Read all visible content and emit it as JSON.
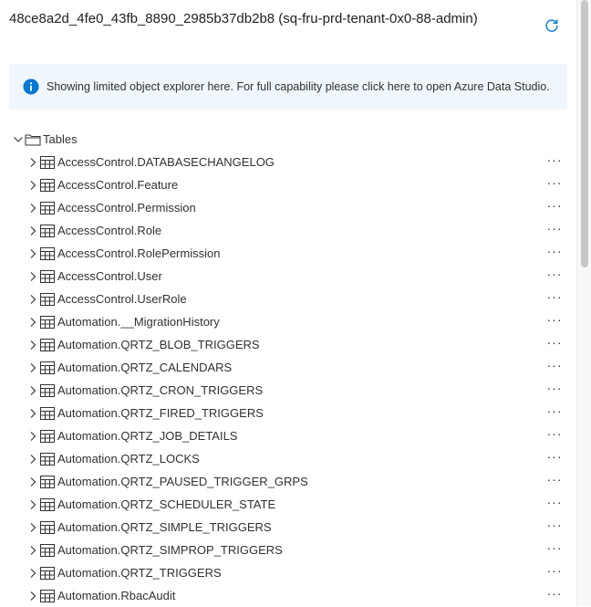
{
  "header": {
    "title": "48ce8a2d_4fe0_43fb_8890_2985b37db2b8 (sq-fru-prd-tenant-0x0-88-admin)",
    "refresh_icon": "refresh-icon"
  },
  "banner": {
    "icon": "info-icon",
    "text": "Showing limited object explorer here. For full capability please click here to open Azure Data Studio.",
    "background": "#eff6fc",
    "icon_color": "#0078d4"
  },
  "tree": {
    "root_label": "Tables",
    "root_expanded": true,
    "more_label": "···",
    "items": [
      "AccessControl.DATABASECHANGELOG",
      "AccessControl.Feature",
      "AccessControl.Permission",
      "AccessControl.Role",
      "AccessControl.RolePermission",
      "AccessControl.User",
      "AccessControl.UserRole",
      "Automation.__MigrationHistory",
      "Automation.QRTZ_BLOB_TRIGGERS",
      "Automation.QRTZ_CALENDARS",
      "Automation.QRTZ_CRON_TRIGGERS",
      "Automation.QRTZ_FIRED_TRIGGERS",
      "Automation.QRTZ_JOB_DETAILS",
      "Automation.QRTZ_LOCKS",
      "Automation.QRTZ_PAUSED_TRIGGER_GRPS",
      "Automation.QRTZ_SCHEDULER_STATE",
      "Automation.QRTZ_SIMPLE_TRIGGERS",
      "Automation.QRTZ_SIMPROP_TRIGGERS",
      "Automation.QRTZ_TRIGGERS",
      "Automation.RbacAudit"
    ]
  }
}
